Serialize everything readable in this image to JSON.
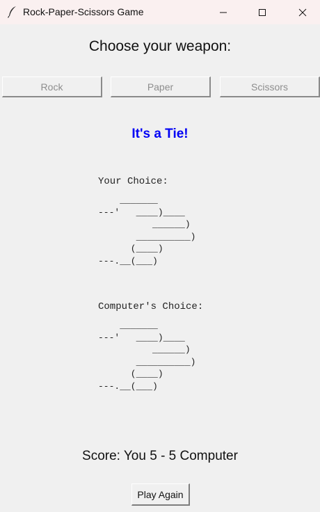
{
  "window": {
    "title": "Rock-Paper-Scissors Game",
    "icon": "feather-icon"
  },
  "controls": {
    "minimize_icon": "minimize-icon",
    "maximize_icon": "maximize-icon",
    "close_icon": "close-icon"
  },
  "heading": "Choose your weapon:",
  "choices": [
    {
      "label": "Rock"
    },
    {
      "label": "Paper"
    },
    {
      "label": "Scissors"
    }
  ],
  "result": {
    "text": "It's a Tie!",
    "color": "#0000f5"
  },
  "player": {
    "label": "Your Choice:",
    "art": "    _______\n---'   ____)____\n          ______)\n       __________)\n      (____)\n---.__(___)"
  },
  "computer": {
    "label": "Computer's Choice:",
    "art": "    _______\n---'   ____)____\n          ______)\n       __________)\n      (____)\n---.__(___)"
  },
  "score": {
    "text": "Score: You 5 - 5 Computer"
  },
  "play_again": {
    "label": "Play Again"
  },
  "colors": {
    "background": "#f0f0f0",
    "titlebar": "#faf0f0",
    "disabled_text": "#8d8d8d"
  }
}
